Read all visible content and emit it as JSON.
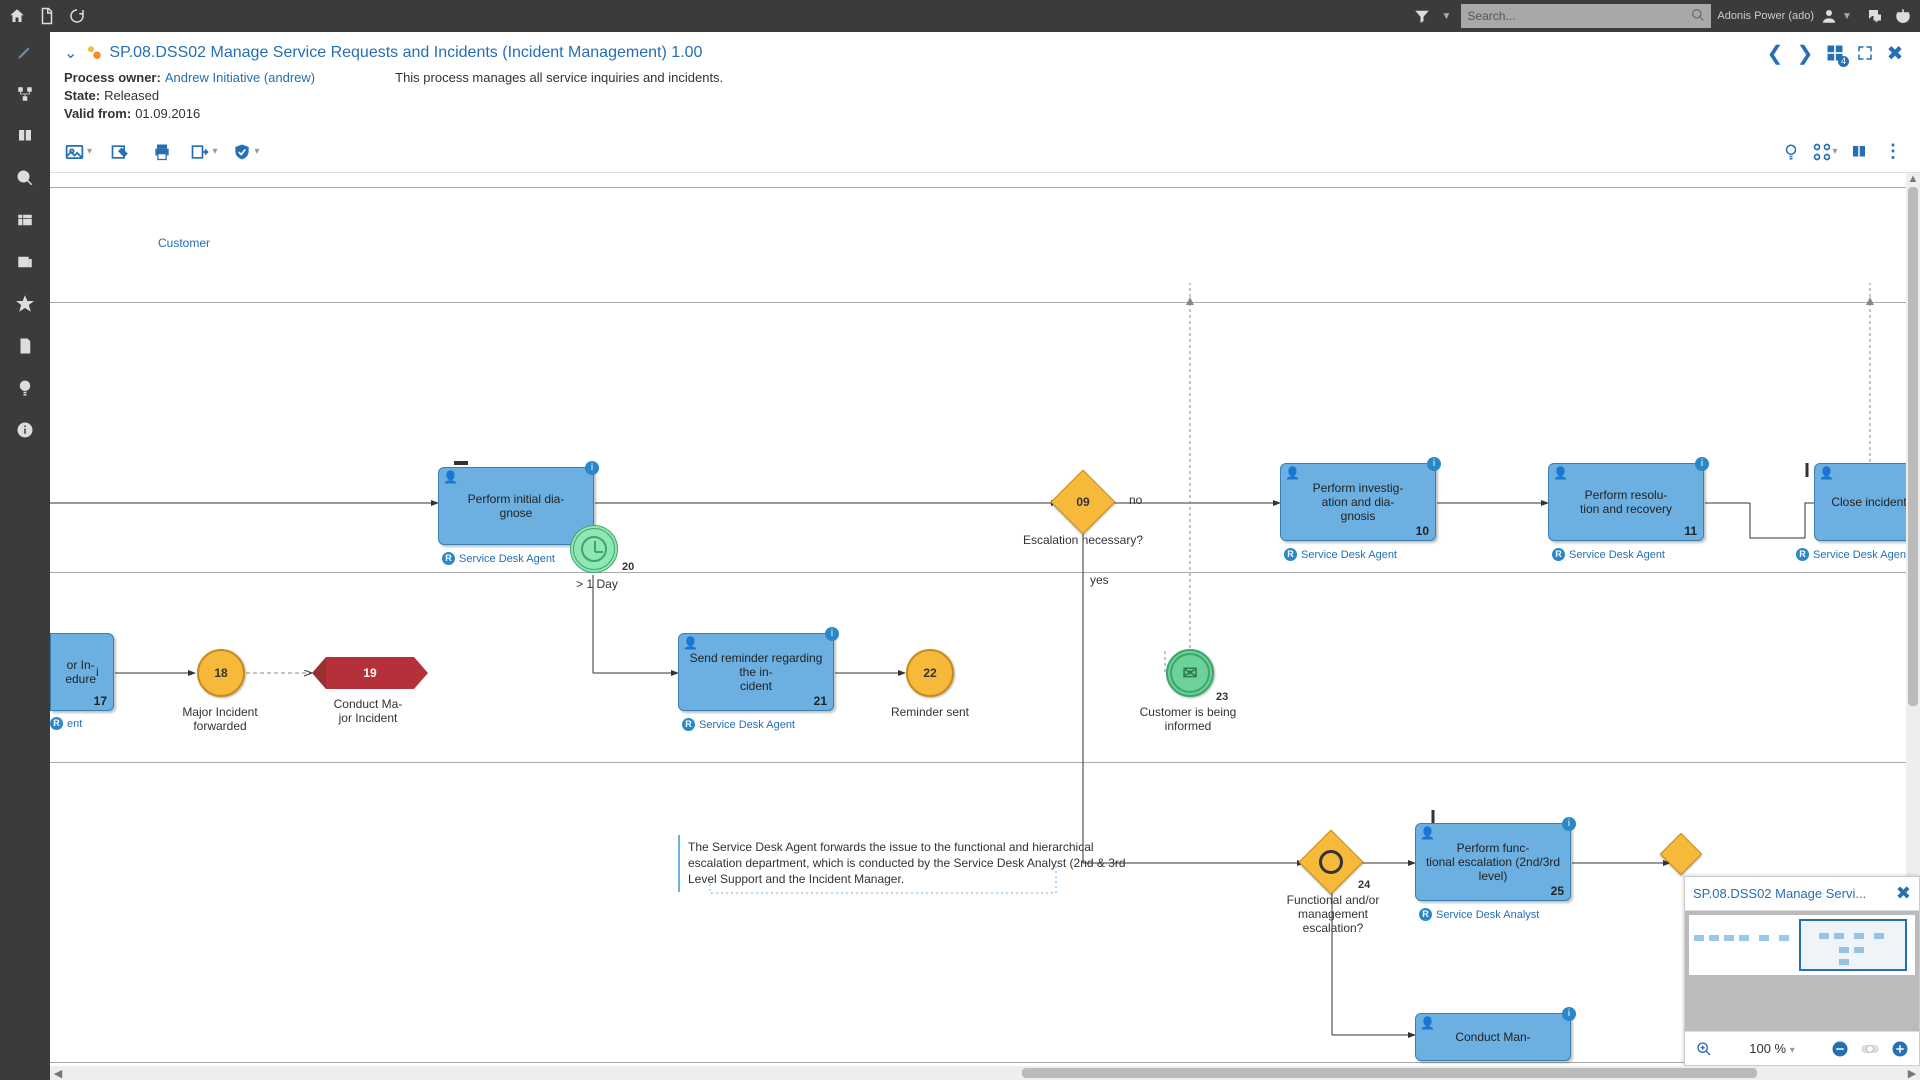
{
  "topbar": {
    "searchPlaceholder": "Search...",
    "user": "Adonis Power (ado)"
  },
  "header": {
    "title": "SP.08.DSS02 Manage Service Requests and Incidents (Incident Management) 1.00",
    "processOwnerLabel": "Process owner:",
    "processOwner": "Andrew Initiative (andrew)",
    "stateLabel": "State:",
    "state": "Released",
    "validFromLabel": "Valid from:",
    "validFrom": "01.09.2016",
    "description": "This process manages all service inquiries and incidents.",
    "gridBadge": "4"
  },
  "roles": {
    "sda": "Service Desk Agent",
    "analyst": "Service Desk Analyst"
  },
  "lanes": {
    "customer": "Customer"
  },
  "tasks": {
    "diagnose": {
      "label": "Perform initial dia-\ngnose",
      "num": ""
    },
    "reminder": {
      "label": "Send reminder regarding the in-\ncident",
      "num": "21"
    },
    "investigate": {
      "label": "Perform investig-\nation and dia-\ngnosis",
      "num": "10"
    },
    "resolution": {
      "label": "Perform resolu-\ntion and recovery",
      "num": "11"
    },
    "close": {
      "label": "Close incident",
      "num": ""
    },
    "funcEsc": {
      "label": "Perform func-\ntional escalation (2nd/3rd level)",
      "num": "25"
    },
    "mgmtEsc": {
      "label": "Conduct Man-"
    },
    "partialLeft": {
      "label": "or In-\nedure",
      "num": "17",
      "roleFrag": "ent"
    }
  },
  "gateways": {
    "escalation": {
      "num": "09",
      "label": "Escalation necessary?"
    },
    "funcMgmt": {
      "num": "24",
      "label": "Functional and/or management escalation?"
    }
  },
  "events": {
    "majorFwd": {
      "num": "18",
      "label": "Major Incident forwarded"
    },
    "conductMajor": {
      "num": "19",
      "label": "Conduct Ma-\njor Incident"
    },
    "reminderSent": {
      "num": "22",
      "label": "Reminder sent"
    },
    "customerInformed": {
      "num": "23",
      "label": "Customer is being informed"
    }
  },
  "timer": {
    "num": "20",
    "label": "> 1 Day"
  },
  "edges": {
    "no": "no",
    "yes": "yes"
  },
  "annotation": "The Service Desk Agent forwards the issue to the functional and hierarchical escalation department, which is conducted by the Service Desk Analyst (2nd & 3rd Level Support and the Incident Manager.",
  "minimap": {
    "title": "SP.08.DSS02 Manage Servi...",
    "zoom": "100 %"
  }
}
